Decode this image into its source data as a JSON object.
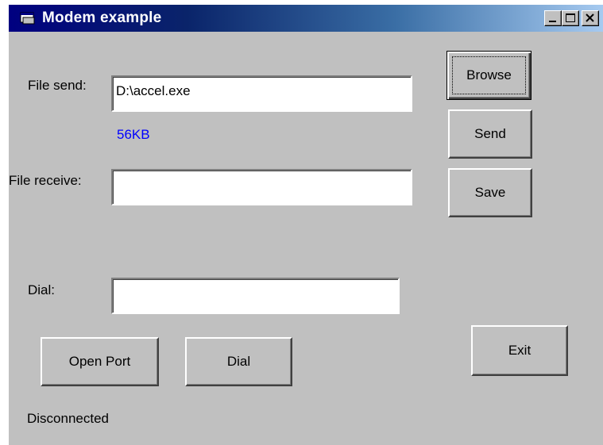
{
  "window": {
    "title": "Modem example",
    "icon": "app-window-icon"
  },
  "titlebar_buttons": {
    "minimize": "minimize-icon",
    "maximize": "maximize-icon",
    "close": "close-icon"
  },
  "send": {
    "label": "File send:",
    "value": "D:\\accel.exe",
    "size": "56KB"
  },
  "receive": {
    "label": "File receive:",
    "value": ""
  },
  "dial": {
    "label": "Dial:",
    "value": ""
  },
  "buttons": {
    "browse": "Browse",
    "send": "Send",
    "save": "Save",
    "open_port": "Open Port",
    "dial": "Dial",
    "exit": "Exit"
  },
  "status": "Disconnected",
  "colors": {
    "titlebar_start": "#000080",
    "titlebar_end": "#a6caf0",
    "size_text": "#0000ff",
    "face": "#c0c0c0"
  }
}
